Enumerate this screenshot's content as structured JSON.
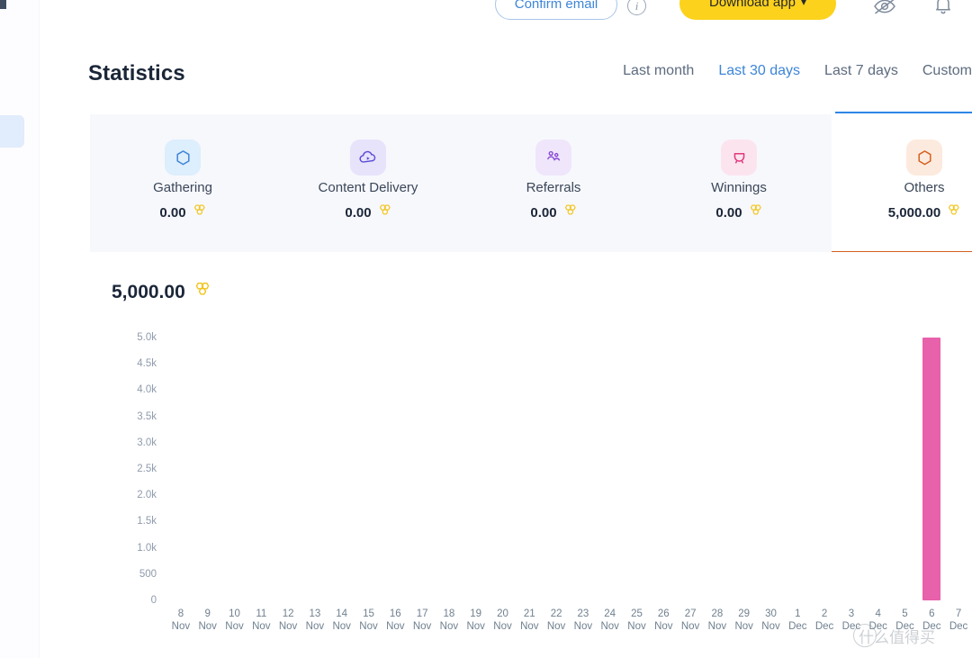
{
  "topbar": {
    "confirm_email_label": "Confirm email",
    "info_icon": "info-icon",
    "download_app_label": "Download app",
    "download_app_chevron": "⌄",
    "eye_off_icon": "eye-off-icon",
    "bell_icon": "bell-icon"
  },
  "section": {
    "title": "Statistics"
  },
  "range_tabs": [
    {
      "label": "Last month",
      "active": false
    },
    {
      "label": "Last 30 days",
      "active": true
    },
    {
      "label": "Last 7 days",
      "active": false
    },
    {
      "label": "Custom",
      "active": false
    }
  ],
  "cards": [
    {
      "label": "Gathering",
      "value": "0.00",
      "icon": "hexagon-icon",
      "accent": "#3d85d8",
      "glow": "#ddeefc",
      "selected": false
    },
    {
      "label": "Content Delivery",
      "value": "0.00",
      "icon": "cloud-play-icon",
      "accent": "#5b4bd6",
      "glow": "#e7e3fb",
      "selected": false
    },
    {
      "label": "Referrals",
      "value": "0.00",
      "icon": "people-icon",
      "accent": "#8a4bd6",
      "glow": "#efe6fb",
      "selected": false
    },
    {
      "label": "Winnings",
      "value": "0.00",
      "icon": "trophy-cup-icon",
      "accent": "#e0397c",
      "glow": "#fce4ef",
      "selected": false
    },
    {
      "label": "Others",
      "value": "5,000.00",
      "icon": "hexagon-icon",
      "accent": "#d4601f",
      "glow": "#fdeade",
      "selected": true
    }
  ],
  "token_icon": "honeycomb-token-icon",
  "chart_panel": {
    "total_value": "5,000.00"
  },
  "colors": {
    "accent_blue": "#3d85d8",
    "accent_yellow": "#fcd21c",
    "selected_underline": "#d4601f",
    "bar": "#e861ab",
    "token": "#f2c41a"
  },
  "watermark": {
    "text": "什么值得买"
  },
  "chart_data": {
    "type": "bar",
    "title": "5,000.00",
    "xlabel": "",
    "ylabel": "",
    "ylim": [
      0,
      5000
    ],
    "grid": false,
    "legend": false,
    "ytick_labels": [
      "5.0k",
      "4.5k",
      "4.0k",
      "3.5k",
      "3.0k",
      "2.5k",
      "2.0k",
      "1.5k",
      "1.0k",
      "500",
      "0"
    ],
    "ytick_values": [
      5000,
      4500,
      4000,
      3500,
      3000,
      2500,
      2000,
      1500,
      1000,
      500,
      0
    ],
    "categories": [
      "8 Nov",
      "9 Nov",
      "10 Nov",
      "11 Nov",
      "12 Nov",
      "13 Nov",
      "14 Nov",
      "15 Nov",
      "16 Nov",
      "17 Nov",
      "18 Nov",
      "19 Nov",
      "20 Nov",
      "21 Nov",
      "22 Nov",
      "23 Nov",
      "24 Nov",
      "25 Nov",
      "26 Nov",
      "27 Nov",
      "28 Nov",
      "29 Nov",
      "30 Nov",
      "1 Dec",
      "2 Dec",
      "3 Dec",
      "4 Dec",
      "5 Dec",
      "6 Dec",
      "7 Dec"
    ],
    "day_numbers": [
      "8",
      "9",
      "10",
      "11",
      "12",
      "13",
      "14",
      "15",
      "16",
      "17",
      "18",
      "19",
      "20",
      "21",
      "22",
      "23",
      "24",
      "25",
      "26",
      "27",
      "28",
      "29",
      "30",
      "1",
      "2",
      "3",
      "4",
      "5",
      "6",
      "7"
    ],
    "month_labels": [
      "Nov",
      "Nov",
      "Nov",
      "Nov",
      "Nov",
      "Nov",
      "Nov",
      "Nov",
      "Nov",
      "Nov",
      "Nov",
      "Nov",
      "Nov",
      "Nov",
      "Nov",
      "Nov",
      "Nov",
      "Nov",
      "Nov",
      "Nov",
      "Nov",
      "Nov",
      "Nov",
      "Dec",
      "Dec",
      "Dec",
      "Dec",
      "Dec",
      "Dec",
      "Dec"
    ],
    "values": [
      0,
      0,
      0,
      0,
      0,
      0,
      0,
      0,
      0,
      0,
      0,
      0,
      0,
      0,
      0,
      0,
      0,
      0,
      0,
      0,
      0,
      0,
      0,
      0,
      0,
      0,
      0,
      0,
      5000,
      0
    ]
  }
}
